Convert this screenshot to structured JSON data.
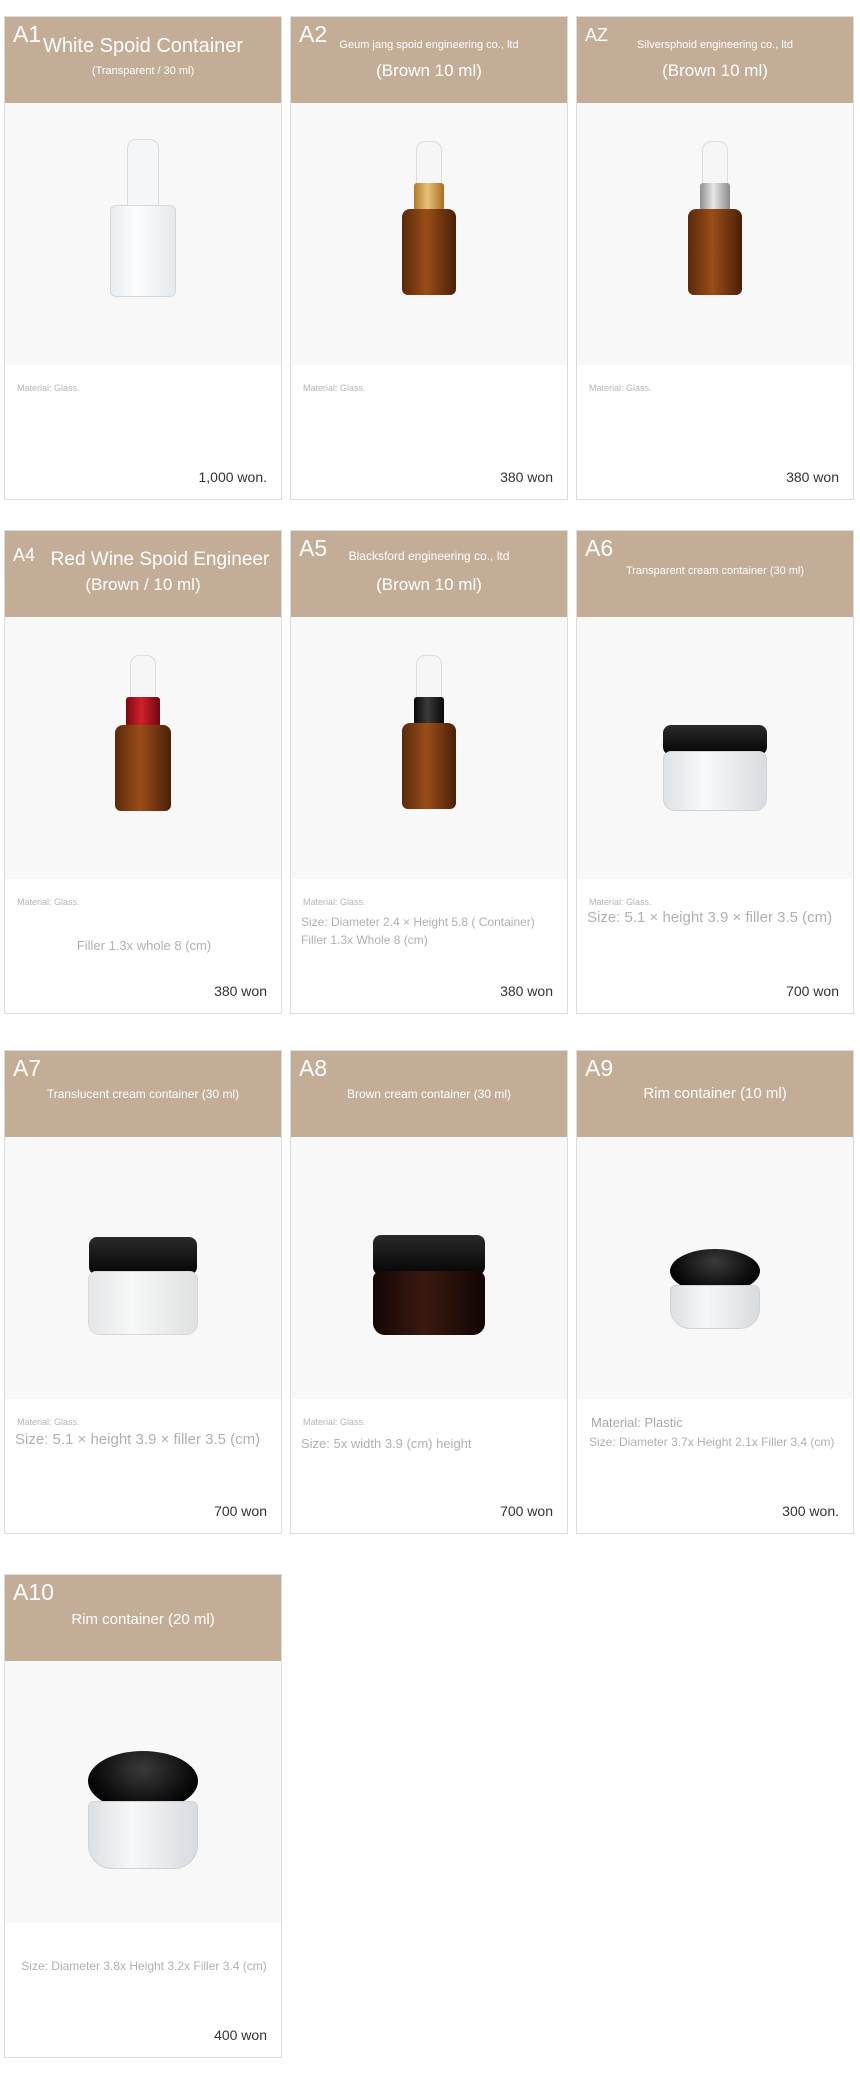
{
  "colors": {
    "header": "#c3ad96",
    "card_border": "#dcdcdc",
    "image_bg": "#f8f8f8",
    "price_text": "#333333"
  },
  "products": [
    {
      "code": "A1",
      "title": "White Spoid Container",
      "subtitle": "(Transparent / 30 ml)",
      "material": "Material: Glass.",
      "size": "",
      "price": "1,000 won.",
      "image": "clear-dropper-bottle"
    },
    {
      "code": "A2",
      "title": "Geum jang spoid engineering co., ltd",
      "subtitle": "(Brown 10 ml)",
      "material": "Material: Glass.",
      "size": "",
      "price": "380 won",
      "image": "amber-dropper-bottle-gold-collar"
    },
    {
      "code": "AZ",
      "title": "Silversphoid engineering co., ltd",
      "subtitle": "(Brown 10 ml)",
      "material": "Material: Glass.",
      "size": "",
      "price": "380 won",
      "image": "amber-dropper-bottle-silver-collar"
    },
    {
      "code": "A4",
      "title": "Red Wine Spoid Engineer",
      "subtitle": "(Brown / 10 ml)",
      "material": "Material: Glass.",
      "size": "Filler 1.3x whole 8 (cm)",
      "price": "380 won",
      "image": "amber-dropper-bottle-red-collar"
    },
    {
      "code": "A5",
      "title": "Blacksford engineering co., ltd",
      "subtitle": "(Brown 10 ml)",
      "material": "Material: Glass.",
      "size": "Size: Diameter 2.4 × Height 5.8 ( Container) Filler 1.3x Whole 8 (cm)",
      "price": "380 won",
      "image": "amber-dropper-bottle-black-collar"
    },
    {
      "code": "A6",
      "title": "Transparent cream container (30 ml)",
      "subtitle": "",
      "material": "Material: Glass.",
      "size": "Size: 5.1 × height 3.9 × filler 3.5 (cm)",
      "price": "700 won",
      "image": "clear-cream-jar"
    },
    {
      "code": "A7",
      "title": "Translucent cream container (30 ml)",
      "subtitle": "",
      "material": "Material: Glass.",
      "size": "Size: 5.1 × height 3.9 × filler 3.5 (cm)",
      "price": "700 won",
      "image": "frosted-cream-jar"
    },
    {
      "code": "A8",
      "title": "Brown cream container (30 ml)",
      "subtitle": "",
      "material": "Material: Glass.",
      "size": "Size: 5x width 3.9 (cm) height",
      "price": "700 won",
      "image": "brown-cream-jar"
    },
    {
      "code": "A9",
      "title": "Rim container (10 ml)",
      "subtitle": "",
      "material": "Material: Plastic",
      "size": "Size: Diameter 3.7x Height 2.1x Filler 3.4 (cm)",
      "price": "300 won.",
      "image": "small-rim-jar"
    },
    {
      "code": "A10",
      "title": "Rim container (20 ml)",
      "subtitle": "",
      "material": "",
      "size": "Size: Diameter 3.8x Height 3.2x Filler 3.4 (cm)",
      "price": "400 won",
      "image": "rim-jar"
    }
  ]
}
